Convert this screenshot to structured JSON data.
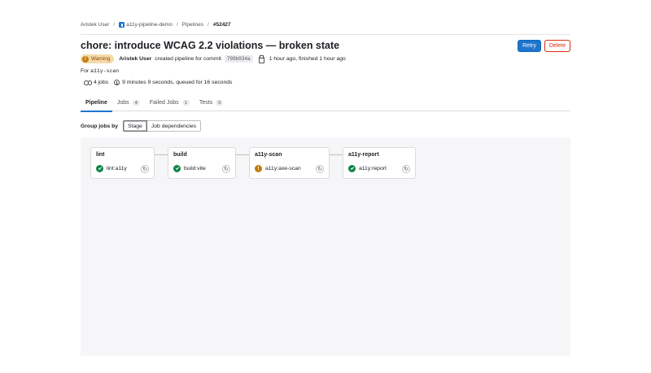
{
  "breadcrumb": {
    "user": "Aristek User",
    "project": "a11y-pipeline-demo",
    "section": "Pipelines",
    "current": "#52427"
  },
  "header": {
    "title": "chore: introduce WCAG 2.2 violations — broken state",
    "retry_label": "Retry",
    "delete_label": "Delete"
  },
  "meta": {
    "status_badge": "Warning",
    "author": "Aristek User",
    "action_text": "created pipeline for commit",
    "commit_sha": "709b034a",
    "timing": "1 hour ago, finished 1 hour ago",
    "for_label": "For",
    "branch": "a11y-scan",
    "jobs_count": "4 jobs",
    "duration": "9 minutes 9 seconds, queued for 16 seconds"
  },
  "tabs": [
    {
      "label": "Pipeline",
      "count": null
    },
    {
      "label": "Jobs",
      "count": "4"
    },
    {
      "label": "Failed Jobs",
      "count": "1"
    },
    {
      "label": "Tests",
      "count": "0"
    }
  ],
  "group": {
    "label": "Group jobs by",
    "options": [
      "Stage",
      "Job dependencies"
    ],
    "selected": "Stage"
  },
  "stages": [
    {
      "name": "lint",
      "job": "lint:a11y",
      "status": "success"
    },
    {
      "name": "build",
      "job": "build:vite",
      "status": "success"
    },
    {
      "name": "a11y-scan",
      "job": "a11y:axe-scan",
      "status": "warning"
    },
    {
      "name": "a11y-report",
      "job": "a11y:report",
      "status": "success"
    }
  ],
  "colors": {
    "primary": "#1f75cb",
    "danger": "#dd2b0e",
    "success": "#108548",
    "warning": "#c17d10"
  }
}
